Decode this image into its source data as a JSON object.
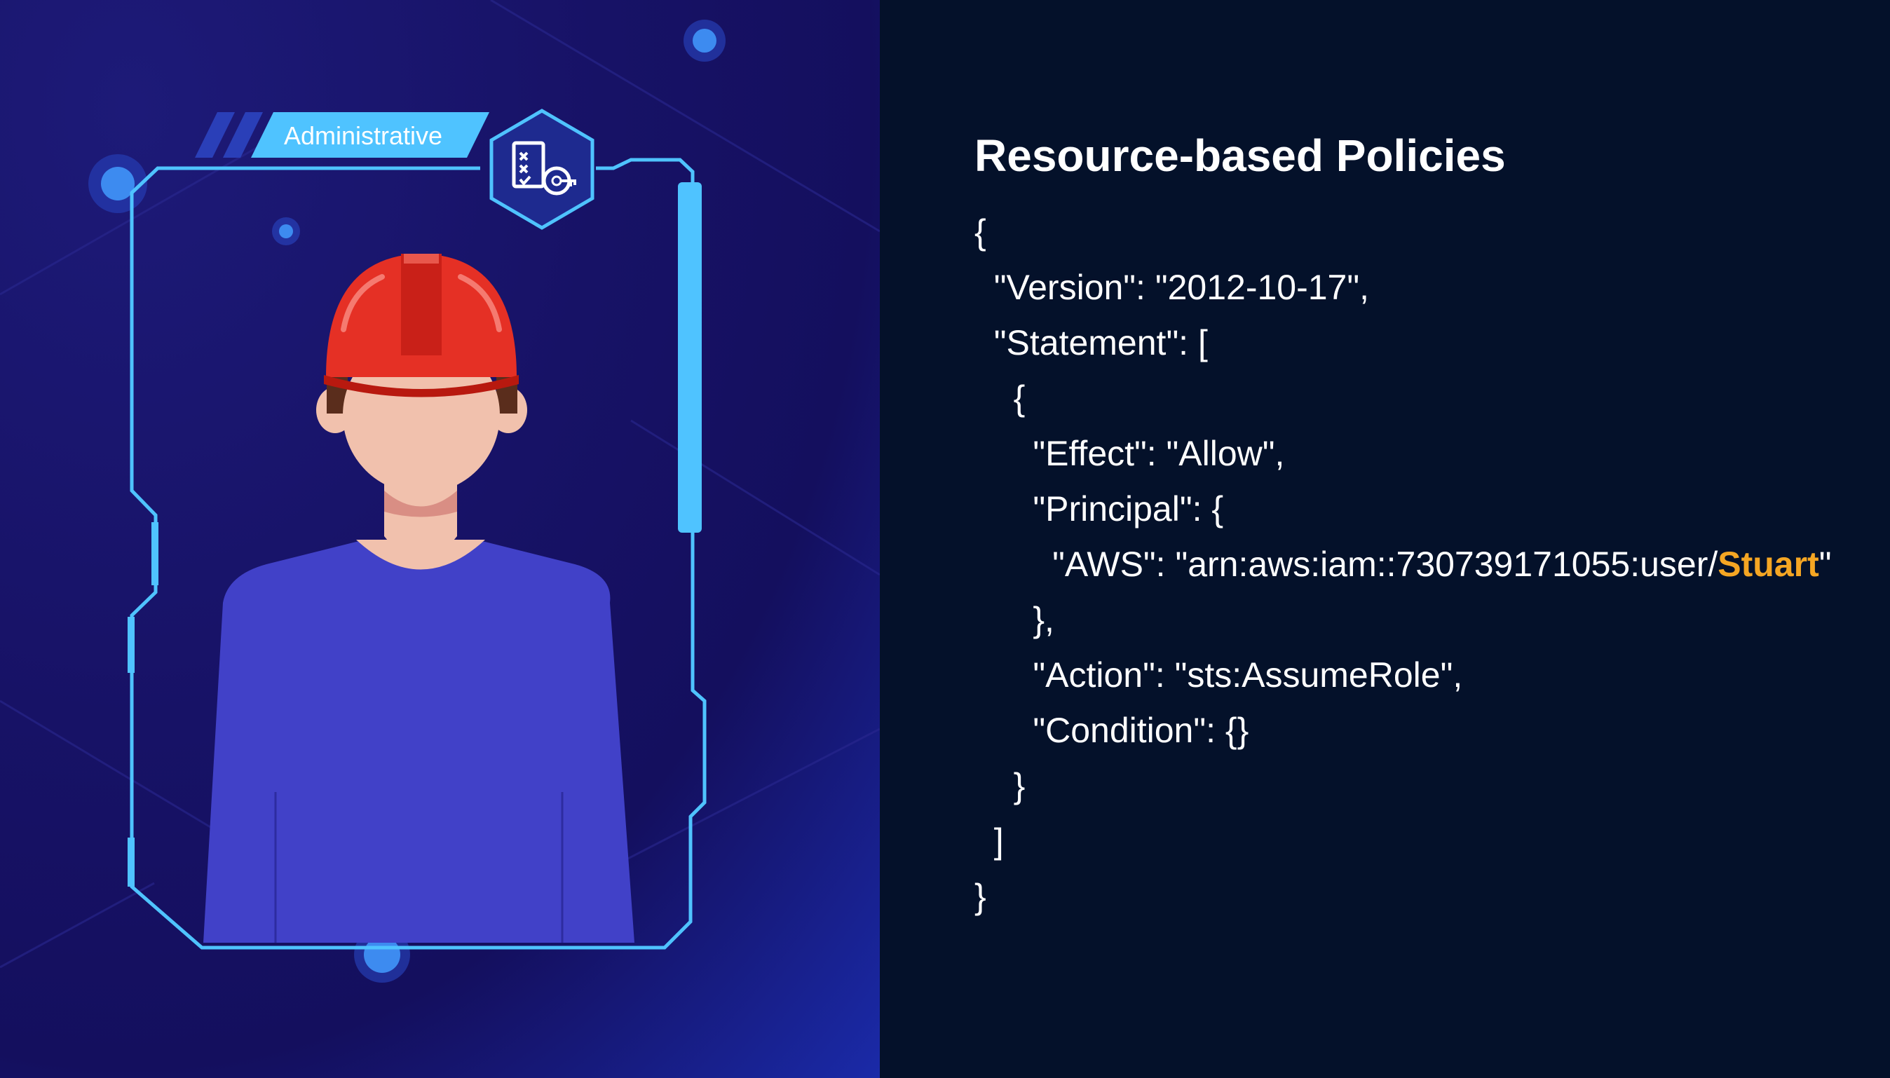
{
  "badge": {
    "label": "Administrative"
  },
  "icons": {
    "badge_icon": "policy-key-icon",
    "avatar": "worker-hardhat-avatar"
  },
  "policy": {
    "title": "Resource-based Policies",
    "lines": [
      "{",
      "  \"Version\": \"2012-10-17\",",
      "  \"Statement\": [",
      "    {",
      "      \"Effect\": \"Allow\",",
      "      \"Principal\": {",
      "        \"AWS\": \"arn:aws:iam::730739171055:user/",
      "      },",
      "      \"Action\": \"sts:AssumeRole\",",
      "      \"Condition\": {}",
      "    }",
      "  ]",
      "}"
    ],
    "highlight_user": "Stuart",
    "highlight_after": "\""
  },
  "colors": {
    "left_bg": "#171266",
    "right_bg": "#04112a",
    "frame": "#4fc3ff",
    "helmet": "#e53025",
    "shirt": "#4141c8",
    "skin": "#f1c1ad",
    "highlight": "#f5a623"
  }
}
